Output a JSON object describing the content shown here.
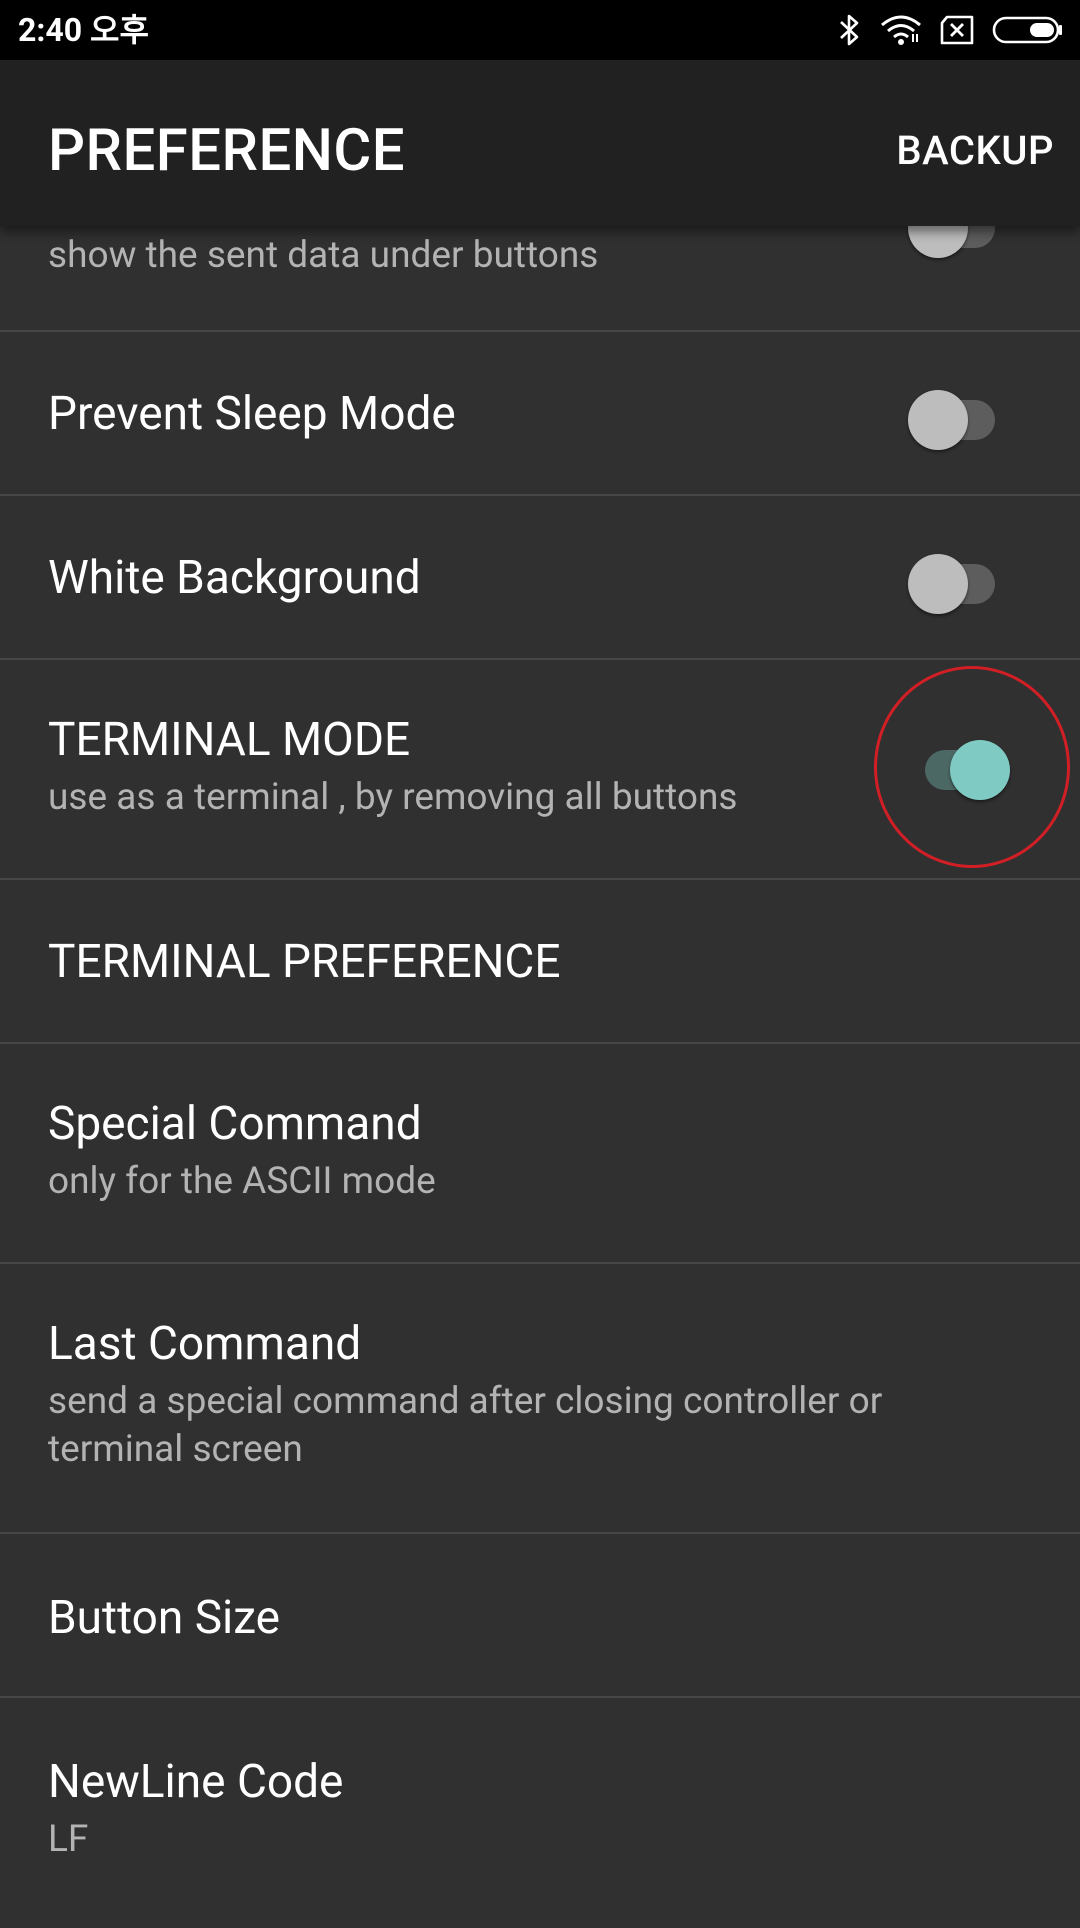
{
  "status_bar": {
    "time": "2:40 오후",
    "icons": [
      "bluetooth-icon",
      "wifi-icon",
      "sim-blocked-icon",
      "battery-icon"
    ]
  },
  "app_bar": {
    "title": "PREFERENCE",
    "action_label": "BACKUP"
  },
  "preferences": [
    {
      "title": "",
      "summary": "show the sent data under buttons",
      "switch_on": false
    },
    {
      "title": "Prevent Sleep Mode",
      "summary": "",
      "switch_on": false
    },
    {
      "title": "White Background",
      "summary": "",
      "switch_on": false
    },
    {
      "title": "TERMINAL MODE",
      "summary": "use as a terminal , by removing all buttons",
      "switch_on": true
    },
    {
      "title": "TERMINAL PREFERENCE",
      "summary": ""
    },
    {
      "title": "Special Command",
      "summary": "only for the ASCII mode"
    },
    {
      "title": "Last Command",
      "summary_line1": "send a special command after closing controller or",
      "summary_line2": "terminal screen"
    },
    {
      "title": "Button Size",
      "summary": ""
    },
    {
      "title": "NewLine Code",
      "summary": "LF"
    }
  ],
  "colors": {
    "background": "#303030",
    "app_bar": "#212121",
    "status_bar": "#000000",
    "divider": "#474747",
    "switch_on_thumb": "#7fcbc4",
    "switch_on_track": "#4c6865",
    "switch_off_thumb": "#bdbdbd",
    "switch_off_track": "#5d5d5d",
    "highlight": "#d21f26"
  }
}
